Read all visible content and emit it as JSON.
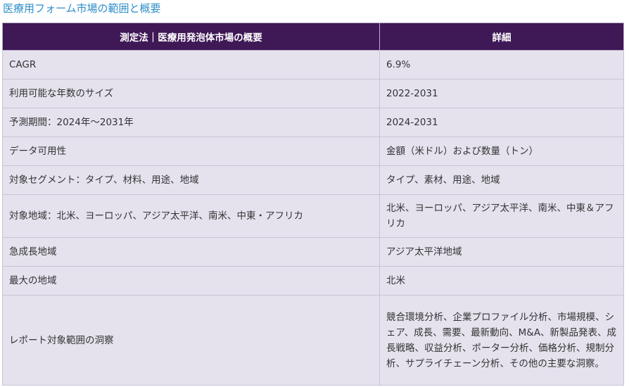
{
  "page": {
    "title": "医療用フォーム市場の範囲と概要"
  },
  "table": {
    "headers": [
      "測定法｜医療用発泡体市場の概要",
      "詳細"
    ],
    "rows": [
      {
        "label": "CAGR",
        "value": "6.9%"
      },
      {
        "label": "利用可能な年数のサイズ",
        "value": "2022-2031"
      },
      {
        "label": "予測期間：2024年～2031年",
        "value": "2024-2031"
      },
      {
        "label": "データ可用性",
        "value": "金額（米ドル）および数量（トン）"
      },
      {
        "label": "対象セグメント：タイプ、材料、用途、地域",
        "value": "タイプ、素材、用途、地域"
      },
      {
        "label": "対象地域：北米、ヨーロッパ、アジア太平洋、南米、中東・アフリカ",
        "value": "北米、ヨーロッパ、アジア太平洋、南米、中東＆アフリカ"
      },
      {
        "label": "急成長地域",
        "value": "アジア太平洋地域"
      },
      {
        "label": "最大の地域",
        "value": "北米"
      },
      {
        "label": "レポート対象範囲の洞察",
        "value": "競合環境分析、企業プロファイル分析、市場規模、シェア、成長、需要、最新動向、M&A、新製品発表、成長戦略、収益分析、ポーター分析、価格分析、規制分析、サプライチェーン分析、その他の主要な洞察。"
      }
    ]
  }
}
